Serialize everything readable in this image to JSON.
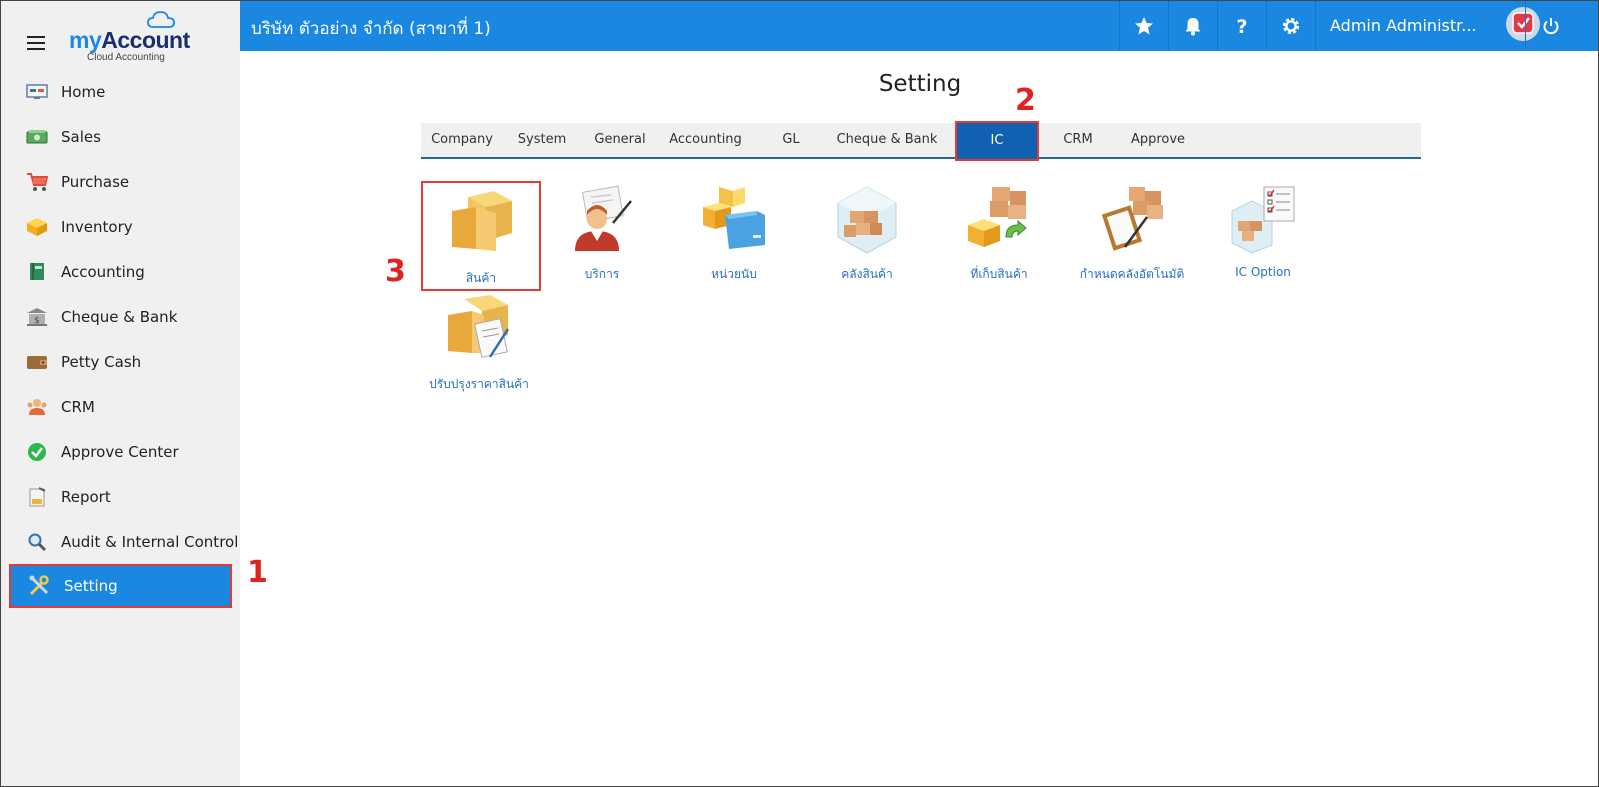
{
  "app": {
    "logo_brand_my": "my",
    "logo_brand_account": "Account",
    "logo_sub": "Cloud Accounting",
    "company": "บริษัท ตัวอย่าง จำกัด (สาขาที่ 1)",
    "user_name": "Admin Administr..."
  },
  "sidebar": {
    "items": [
      {
        "label": "Home",
        "icon": "home-icon"
      },
      {
        "label": "Sales",
        "icon": "sales-icon"
      },
      {
        "label": "Purchase",
        "icon": "cart-icon"
      },
      {
        "label": "Inventory",
        "icon": "box-icon"
      },
      {
        "label": "Accounting",
        "icon": "book-icon"
      },
      {
        "label": "Cheque & Bank",
        "icon": "bank-icon"
      },
      {
        "label": "Petty Cash",
        "icon": "wallet-icon"
      },
      {
        "label": "CRM",
        "icon": "people-icon"
      },
      {
        "label": "Approve Center",
        "icon": "check-circle-icon"
      },
      {
        "label": "Report",
        "icon": "report-icon"
      },
      {
        "label": "Audit & Internal Control",
        "icon": "magnifier-icon"
      },
      {
        "label": "Setting",
        "icon": "tools-icon"
      }
    ]
  },
  "main": {
    "title": "Setting",
    "tabs": [
      "Company",
      "System",
      "General",
      "Accounting",
      "GL",
      "Cheque & Bank",
      "IC",
      "CRM",
      "Approve"
    ],
    "tiles": [
      "สินค้า",
      "บริการ",
      "หน่วยนับ",
      "คลังสินค้า",
      "ที่เก็บสินค้า",
      "กำหนดคลังอัตโนมัติ",
      "IC Option",
      "ปรับปรุงราคาสินค้า"
    ]
  },
  "markers": {
    "m1": "1",
    "m2": "2",
    "m3": "3"
  },
  "colors": {
    "accent": "#1a88e0",
    "highlight": "#e53935",
    "tab_active": "#1260b4",
    "link": "#2a6fc0"
  }
}
